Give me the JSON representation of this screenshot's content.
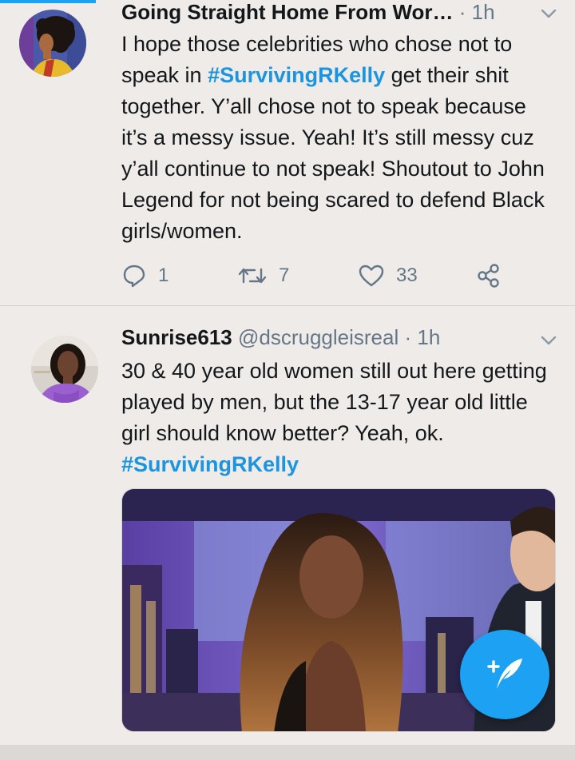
{
  "tweets": [
    {
      "display_name": "Going Straight Home From Wor…",
      "time": "· 1h",
      "text_parts": [
        "I hope those celebrities who chose not to speak in ",
        "#SurvivingRKelly",
        " get their shit together. Y’all chose not to speak because it’s a messy issue. Yeah! It’s still messy cuz y’all continue to not speak! Shoutout to John Legend for not being scared to defend Black girls/women."
      ],
      "reply_count": "1",
      "retweet_count": "7",
      "like_count": "33"
    },
    {
      "display_name": "Sunrise613",
      "handle": "@dscruggleisreal",
      "time": "· 1h",
      "text_parts": [
        "30 & 40 year old women still out here getting played by men, but the 13-17 year old little girl should know better? Yeah, ok. ",
        "#SurvivingRKelly"
      ]
    }
  ],
  "icons": {
    "reply": "reply-icon",
    "retweet": "retweet-icon",
    "like": "heart-icon",
    "share": "share-icon",
    "caret": "chevron-down-icon",
    "compose": "compose-tweet-icon"
  },
  "colors": {
    "background": "#efebe9",
    "accent": "#1da1f2",
    "hashtag": "#1b95e0",
    "secondary_text": "#657786"
  }
}
